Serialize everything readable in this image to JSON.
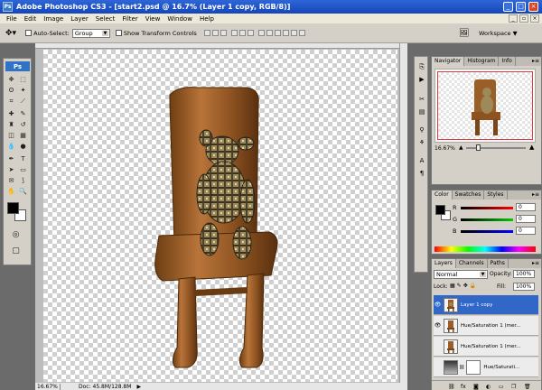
{
  "window": {
    "title": "Adobe Photoshop CS3 - [start2.psd @ 16.7% (Layer 1 copy, RGB/8)]",
    "app_badge": "Ps"
  },
  "menu": [
    "File",
    "Edit",
    "Image",
    "Layer",
    "Select",
    "Filter",
    "View",
    "Window",
    "Help"
  ],
  "options_bar": {
    "auto_select_label": "Auto-Select:",
    "auto_select_value": "Group",
    "transform_label": "Show Transform Controls",
    "workspace_label": "Workspace"
  },
  "tools": {
    "logo": "Ps"
  },
  "document": {
    "zoom": "16.67%",
    "doc_info": "Doc: 45.8M/128.8M"
  },
  "navigator": {
    "tabs": [
      "Navigator",
      "Histogram",
      "Info"
    ],
    "zoom": "16.67%",
    "slider_fraction": 0.2
  },
  "color": {
    "tabs": [
      "Color",
      "Swatches",
      "Styles"
    ],
    "channels": [
      {
        "label": "R",
        "value": "0",
        "color": "#e02020"
      },
      {
        "label": "G",
        "value": "0",
        "color": "#20b020"
      },
      {
        "label": "B",
        "value": "0",
        "color": "#2020e0"
      }
    ],
    "foreground": "#000000",
    "background": "#ffffff"
  },
  "layers": {
    "tabs": [
      "Layers",
      "Channels",
      "Paths"
    ],
    "blend_mode": "Normal",
    "opacity_label": "Opacity:",
    "opacity": "100%",
    "lock_label": "Lock:",
    "fill_label": "Fill:",
    "fill": "100%",
    "rows": [
      {
        "name": "Layer 1 copy",
        "visible": true,
        "selected": true
      },
      {
        "name": "Hue/Saturation 1 (mer...",
        "visible": true,
        "selected": false
      },
      {
        "name": "Hue/Saturation 1 (mer...",
        "visible": false,
        "selected": false
      },
      {
        "name": "Hue/Saturati...",
        "visible": false,
        "selected": false
      }
    ],
    "bottom_icons": [
      "link-icon",
      "fx-icon",
      "mask-icon",
      "adjustment-icon",
      "folder-icon",
      "new-layer-icon",
      "trash-icon"
    ]
  }
}
